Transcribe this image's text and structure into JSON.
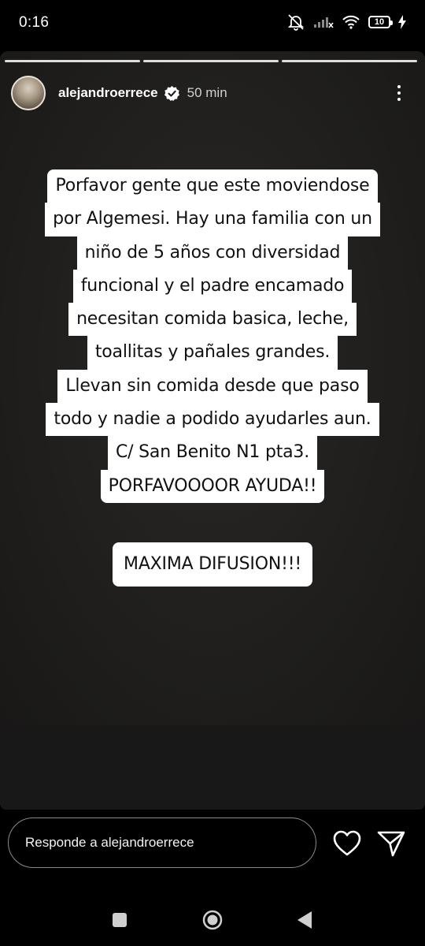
{
  "status_bar": {
    "time": "0:16",
    "battery_level": "10",
    "icons": [
      "mute-icon",
      "signal-icon",
      "wifi-icon",
      "battery-icon",
      "charging-icon"
    ]
  },
  "story": {
    "progress_segments": 3,
    "current_segment": 3,
    "username": "alejandroerrece",
    "verified": true,
    "posted_ago": "50 min",
    "text_lines": [
      "Porfavor gente que este moviendose",
      "por Algemesi. Hay una familia con un",
      "niño de 5 años con diversidad",
      "funcional y el padre encamado",
      "necesitan comida basica, leche,",
      "toallitas y pañales grandes.",
      "Llevan sin comida desde que paso",
      "todo y nadie a podido ayudarles aun.",
      "C/ San Benito N1 pta3.",
      "PORFAVOOOOR AYUDA!!"
    ],
    "highlight_text": "MAXIMA DIFUSION!!!"
  },
  "reply": {
    "placeholder": "Responde a alejandroerrece"
  },
  "colors": {
    "background": "#000000",
    "story_background": "#201f1d",
    "text_highlight": "#ffffff",
    "verified_badge": "#ffffff"
  }
}
